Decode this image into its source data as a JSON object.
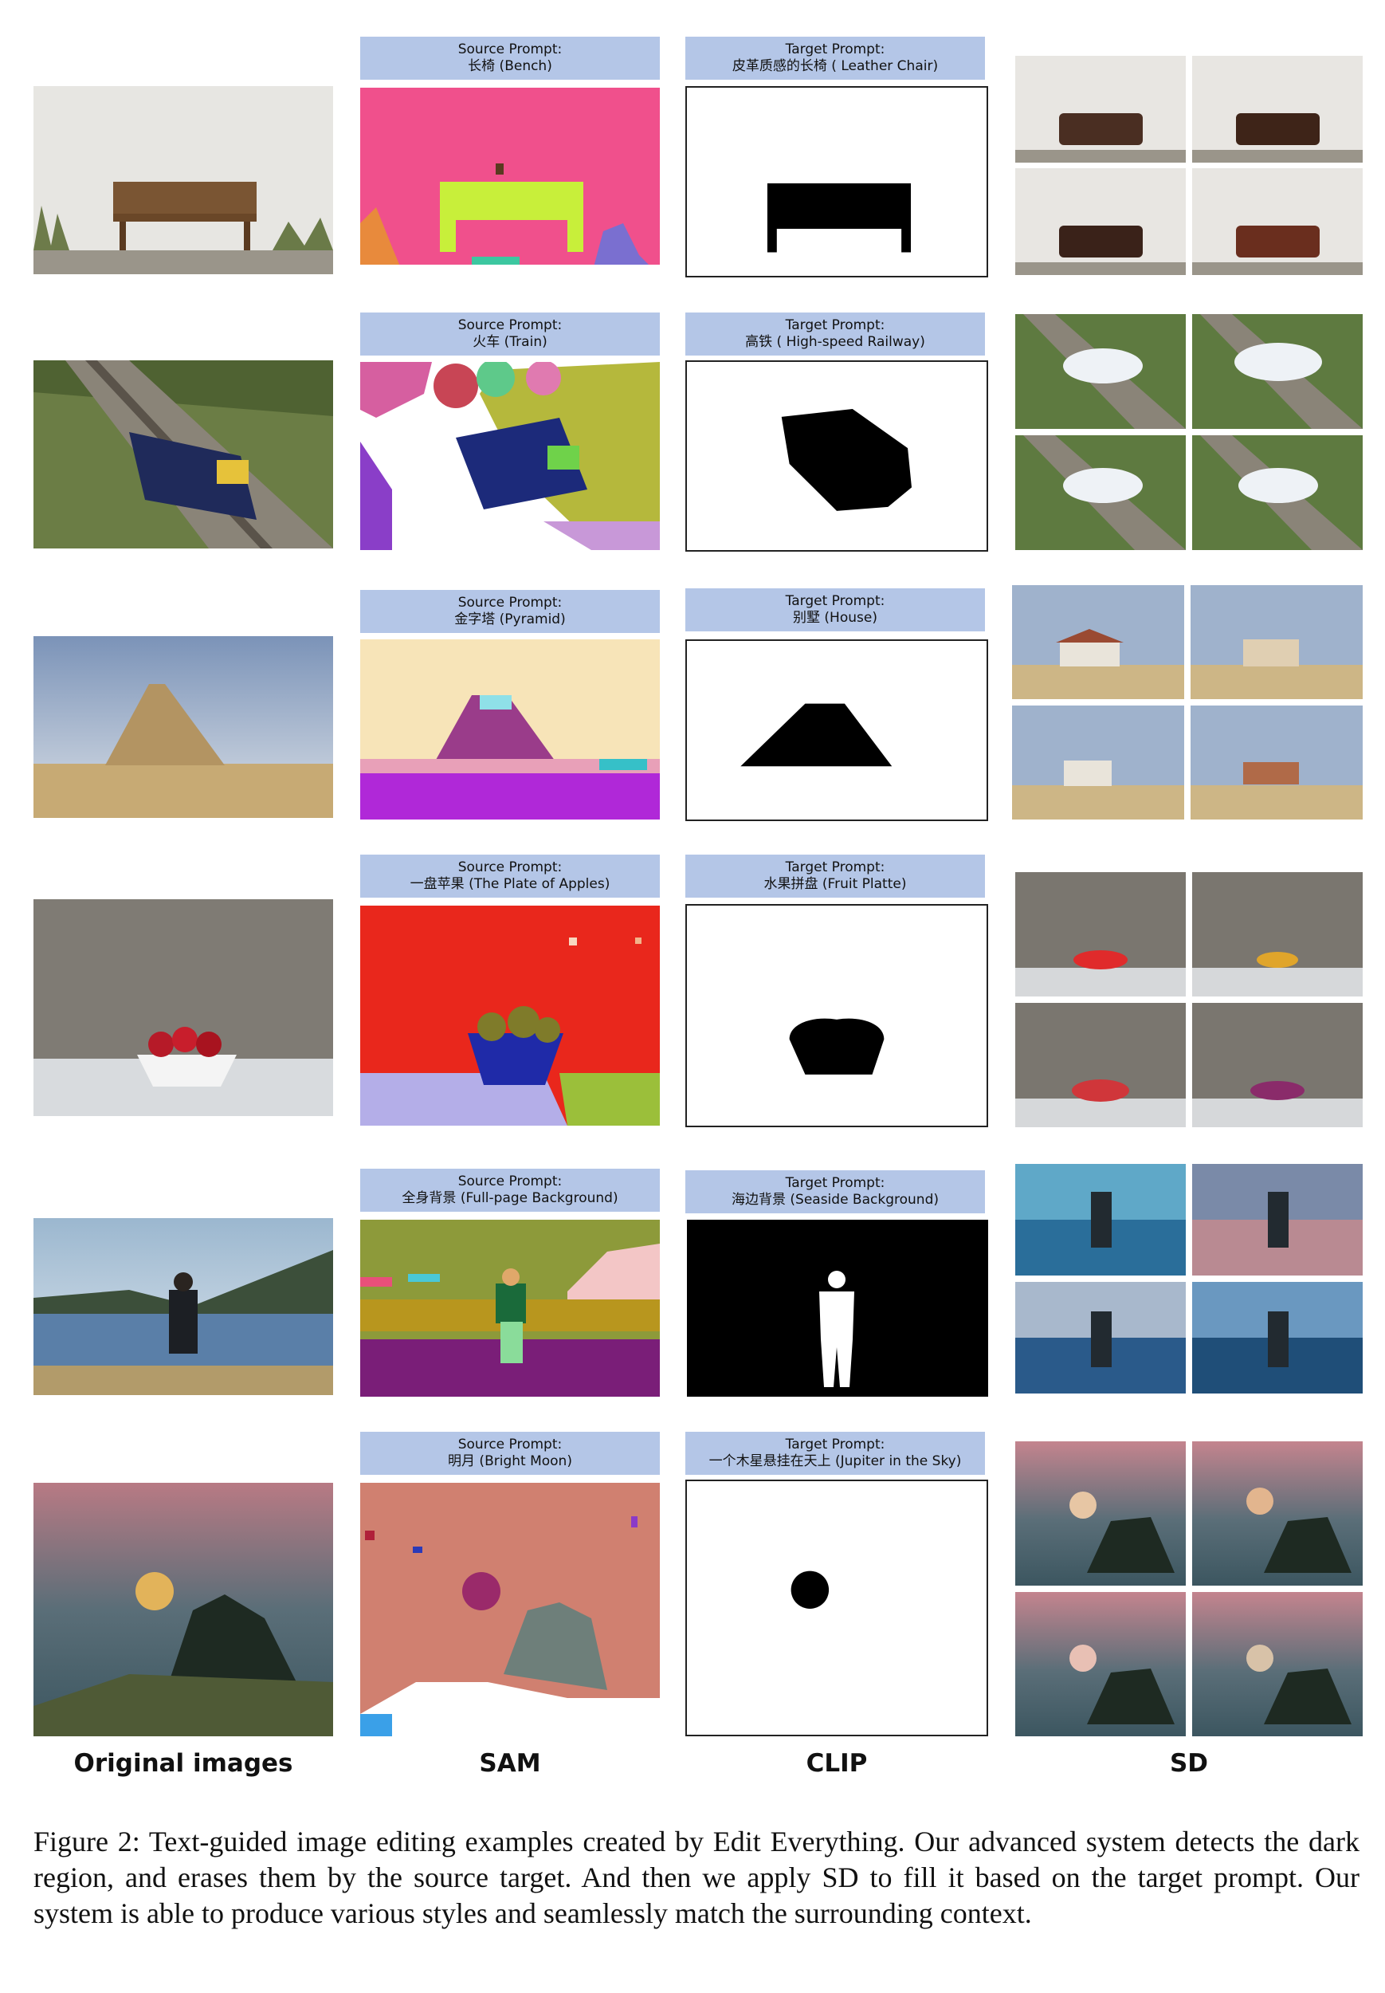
{
  "rows": [
    {
      "id": "bench",
      "original": "bench-photo",
      "sam": "bench-segmentation",
      "source_label": "Source Prompt:",
      "source_text": "长椅 (Bench)",
      "target_label": "Target Prompt:",
      "target_text": "皮革质感的长椅 ( Leather Chair)",
      "sd": "leather-chair-results"
    },
    {
      "id": "train",
      "original": "train-photo",
      "sam": "train-segmentation",
      "source_label": "Source Prompt:",
      "source_text": "火车 (Train)",
      "target_label": "Target Prompt:",
      "target_text": "高铁 ( High-speed Railway)",
      "sd": "high-speed-railway-results"
    },
    {
      "id": "pyramid",
      "original": "pyramid-photo",
      "sam": "pyramid-segmentation",
      "source_label": "Source Prompt:",
      "source_text": "金字塔 (Pyramid)",
      "target_label": "Target Prompt:",
      "target_text": "别墅 (House)",
      "sd": "house-results"
    },
    {
      "id": "apples",
      "original": "apples-photo",
      "sam": "apples-segmentation",
      "source_label": "Source Prompt:",
      "source_text": "一盘苹果 (The Plate of Apples)",
      "target_label": "Target Prompt:",
      "target_text": "水果拼盘 (Fruit Platte)",
      "sd": "fruit-platter-results"
    },
    {
      "id": "background",
      "original": "man-lake-photo",
      "sam": "man-lake-segmentation",
      "source_label": "Source Prompt:",
      "source_text": "全身背景 (Full-page Background)",
      "target_label": "Target Prompt:",
      "target_text": "海边背景 (Seaside Background)",
      "sd": "seaside-results"
    },
    {
      "id": "moon",
      "original": "moon-photo",
      "sam": "moon-segmentation",
      "source_label": "Source Prompt:",
      "source_text": "明月 (Bright Moon)",
      "target_label": "Target Prompt:",
      "target_text": "一个木星悬挂在天上 (Jupiter in the Sky)",
      "sd": "jupiter-results"
    }
  ],
  "column_labels": {
    "original": "Original images",
    "sam": "SAM",
    "clip": "CLIP",
    "sd": "SD"
  },
  "caption": "Figure 2: Text-guided image editing examples created by Edit Everything. Our advanced system detects the dark region, and erases them by the source target. And then we apply SD to fill it based on the target prompt. Our system is able to produce various styles and seamlessly match the surrounding context.",
  "colors": {
    "prompt_bg": "#b4c6e7"
  }
}
